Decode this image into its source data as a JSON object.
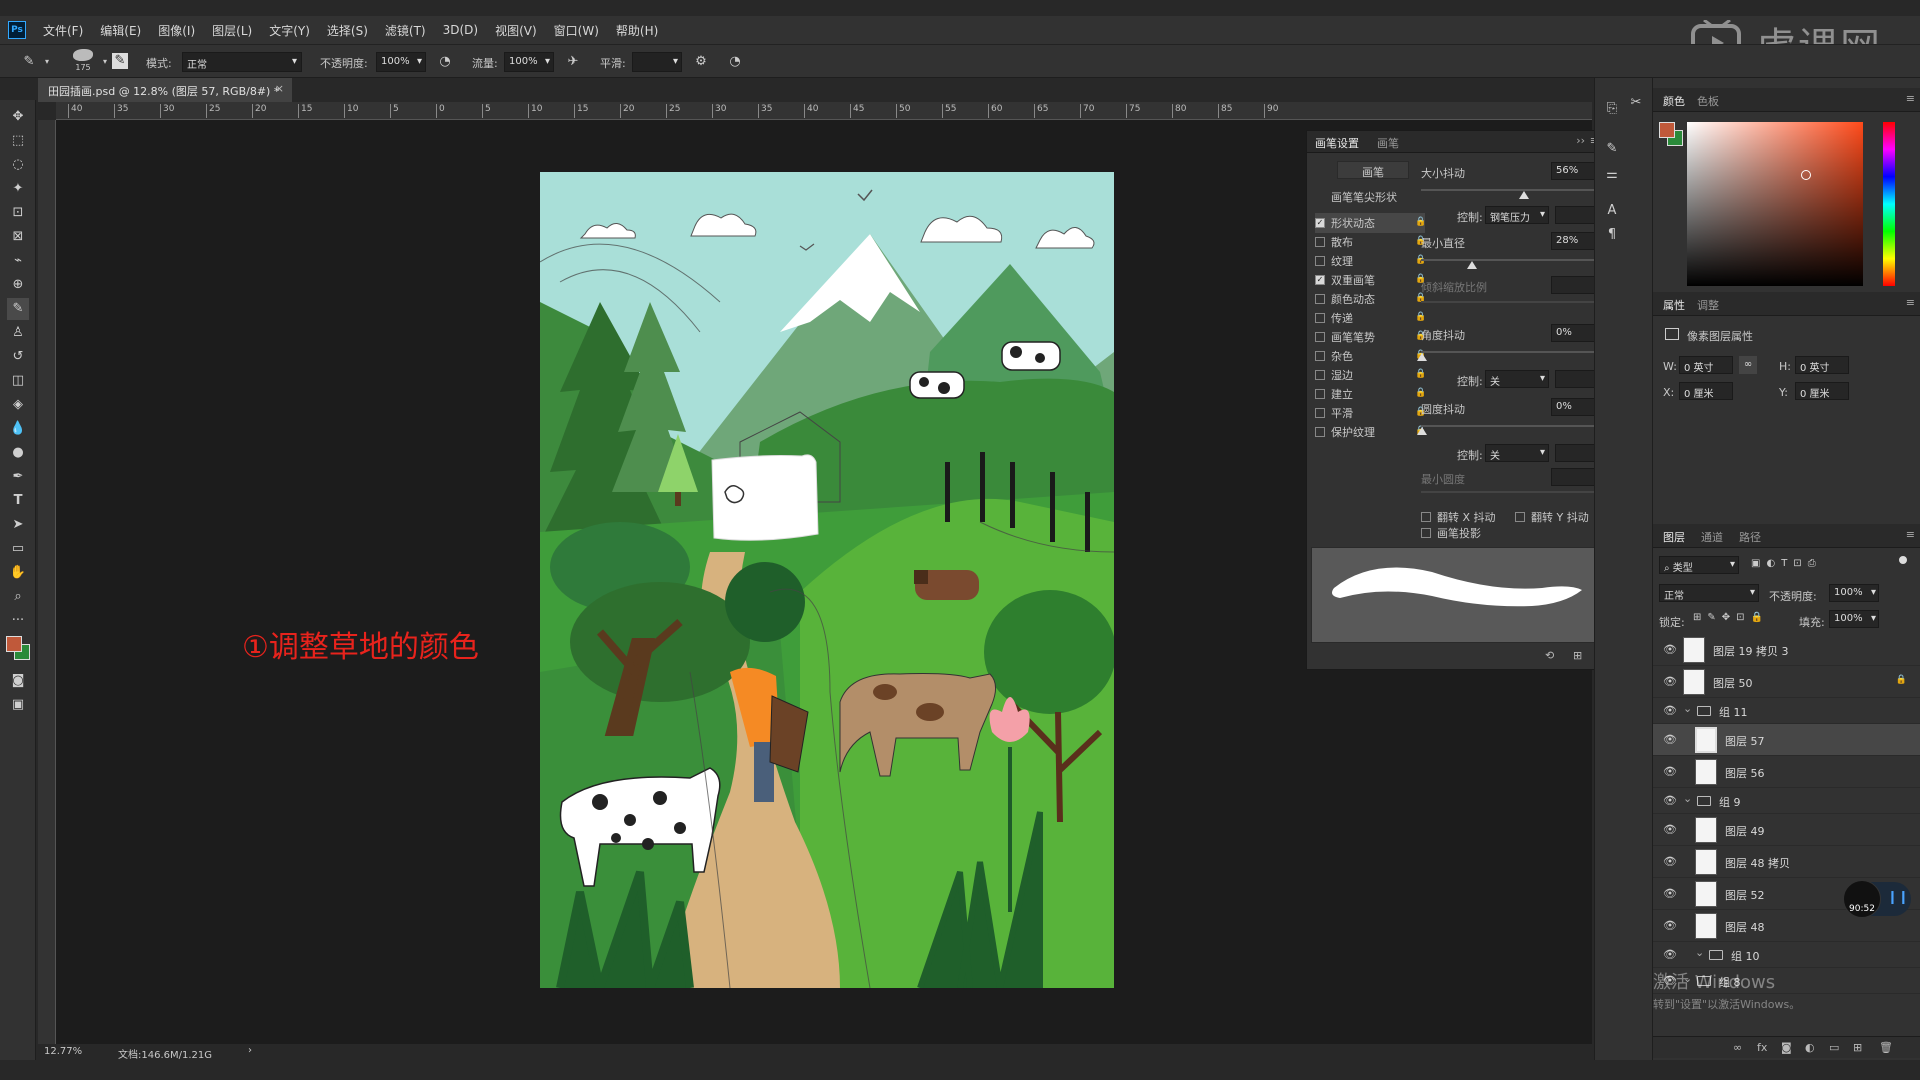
{
  "app": {
    "logo": "Ps"
  },
  "menu": [
    "文件(F)",
    "编辑(E)",
    "图像(I)",
    "图层(L)",
    "文字(Y)",
    "选择(S)",
    "滤镜(T)",
    "3D(D)",
    "视图(V)",
    "窗口(W)",
    "帮助(H)"
  ],
  "watermark": {
    "text": "虎课网",
    "activate_title": "激活 Windows",
    "activate_sub": "转到\"设置\"以激活Windows。"
  },
  "options": {
    "brush_size": "175",
    "mode_label": "模式:",
    "mode_value": "正常",
    "opacity_label": "不透明度:",
    "opacity_value": "100%",
    "flow_label": "流量:",
    "flow_value": "100%",
    "smooth_label": "平滑:",
    "smooth_value": ""
  },
  "document": {
    "tab_title": "田园插画.psd @ 12.8% (图层 57, RGB/8#) *",
    "zoom": "12.77%",
    "doc_size": "文档:146.6M/1.21G",
    "annotation": "①调整草地的颜色",
    "ruler_ticks": [
      "40",
      "35",
      "30",
      "25",
      "20",
      "15",
      "10",
      "5",
      "0",
      "5",
      "10",
      "15",
      "20",
      "25",
      "30",
      "35",
      "40",
      "45",
      "50",
      "55",
      "60",
      "65",
      "70",
      "75",
      "80",
      "85",
      "90"
    ]
  },
  "brush_panel": {
    "tabs": [
      "画笔设置",
      "画笔"
    ],
    "brush_btn": "画笔",
    "tip_shape": "画笔笔尖形状",
    "options": [
      {
        "label": "形状动态",
        "checked": true
      },
      {
        "label": "散布",
        "checked": false
      },
      {
        "label": "纹理",
        "checked": false
      },
      {
        "label": "双重画笔",
        "checked": true
      },
      {
        "label": "颜色动态",
        "checked": false
      },
      {
        "label": "传递",
        "checked": false
      },
      {
        "label": "画笔笔势",
        "checked": false
      },
      {
        "label": "杂色",
        "checked": false
      },
      {
        "label": "湿边",
        "checked": false
      },
      {
        "label": "建立",
        "checked": false
      },
      {
        "label": "平滑",
        "checked": false
      },
      {
        "label": "保护纹理",
        "checked": false
      }
    ],
    "size_jitter_label": "大小抖动",
    "size_jitter_value": "56%",
    "control_label": "控制:",
    "control_pen": "钢笔压力",
    "min_diameter_label": "最小直径",
    "min_diameter_value": "28%",
    "tilt_scale_label": "倾斜缩放比例",
    "angle_jitter_label": "角度抖动",
    "angle_jitter_value": "0%",
    "control_off": "关",
    "roundness_jitter_label": "圆度抖动",
    "roundness_jitter_value": "0%",
    "min_roundness_label": "最小圆度",
    "flip_x": "翻转 X 抖动",
    "flip_y": "翻转 Y 抖动",
    "brush_projection": "画笔投影"
  },
  "color_panel": {
    "tabs": [
      "颜色",
      "色板"
    ],
    "fg_color": "#c0593a",
    "bg_color": "#2a8a3a"
  },
  "properties_panel": {
    "tabs": [
      "属性",
      "调整"
    ],
    "title": "像素图层属性",
    "w_label": "W:",
    "w_value": "0 英寸",
    "h_label": "H:",
    "h_value": "0 英寸",
    "x_label": "X:",
    "x_value": "0 厘米",
    "y_label": "Y:",
    "y_value": "0 厘米"
  },
  "layers_panel": {
    "tabs": [
      "图层",
      "通道",
      "路径"
    ],
    "filter_label": "类型",
    "blend_mode": "正常",
    "opacity_label": "不透明度:",
    "opacity_value": "100%",
    "lock_label": "锁定:",
    "fill_label": "填充:",
    "fill_value": "100%",
    "layers": [
      {
        "name": "图层 19 拷贝 3",
        "type": "layer",
        "indent": 0
      },
      {
        "name": "图层 50",
        "type": "layer",
        "indent": 0
      },
      {
        "name": "组 11",
        "type": "group",
        "indent": 0
      },
      {
        "name": "图层 57",
        "type": "layer",
        "indent": 1,
        "selected": true
      },
      {
        "name": "图层 56",
        "type": "layer",
        "indent": 1
      },
      {
        "name": "组 9",
        "type": "group",
        "indent": 0
      },
      {
        "name": "图层 49",
        "type": "layer",
        "indent": 1
      },
      {
        "name": "图层 48 拷贝",
        "type": "layer",
        "indent": 1
      },
      {
        "name": "图层 52",
        "type": "layer",
        "indent": 1
      },
      {
        "name": "图层 48",
        "type": "layer",
        "indent": 1
      },
      {
        "name": "组 10",
        "type": "group",
        "indent": 1
      },
      {
        "name": "组 8",
        "type": "group",
        "indent": 0
      }
    ],
    "timer": "90:52"
  },
  "colors": {
    "accent": "#31a8ff",
    "annotation": "#e8231c",
    "sky": "#a9dfd8",
    "grass": "#4fa12c",
    "path": "#d7b27e"
  }
}
